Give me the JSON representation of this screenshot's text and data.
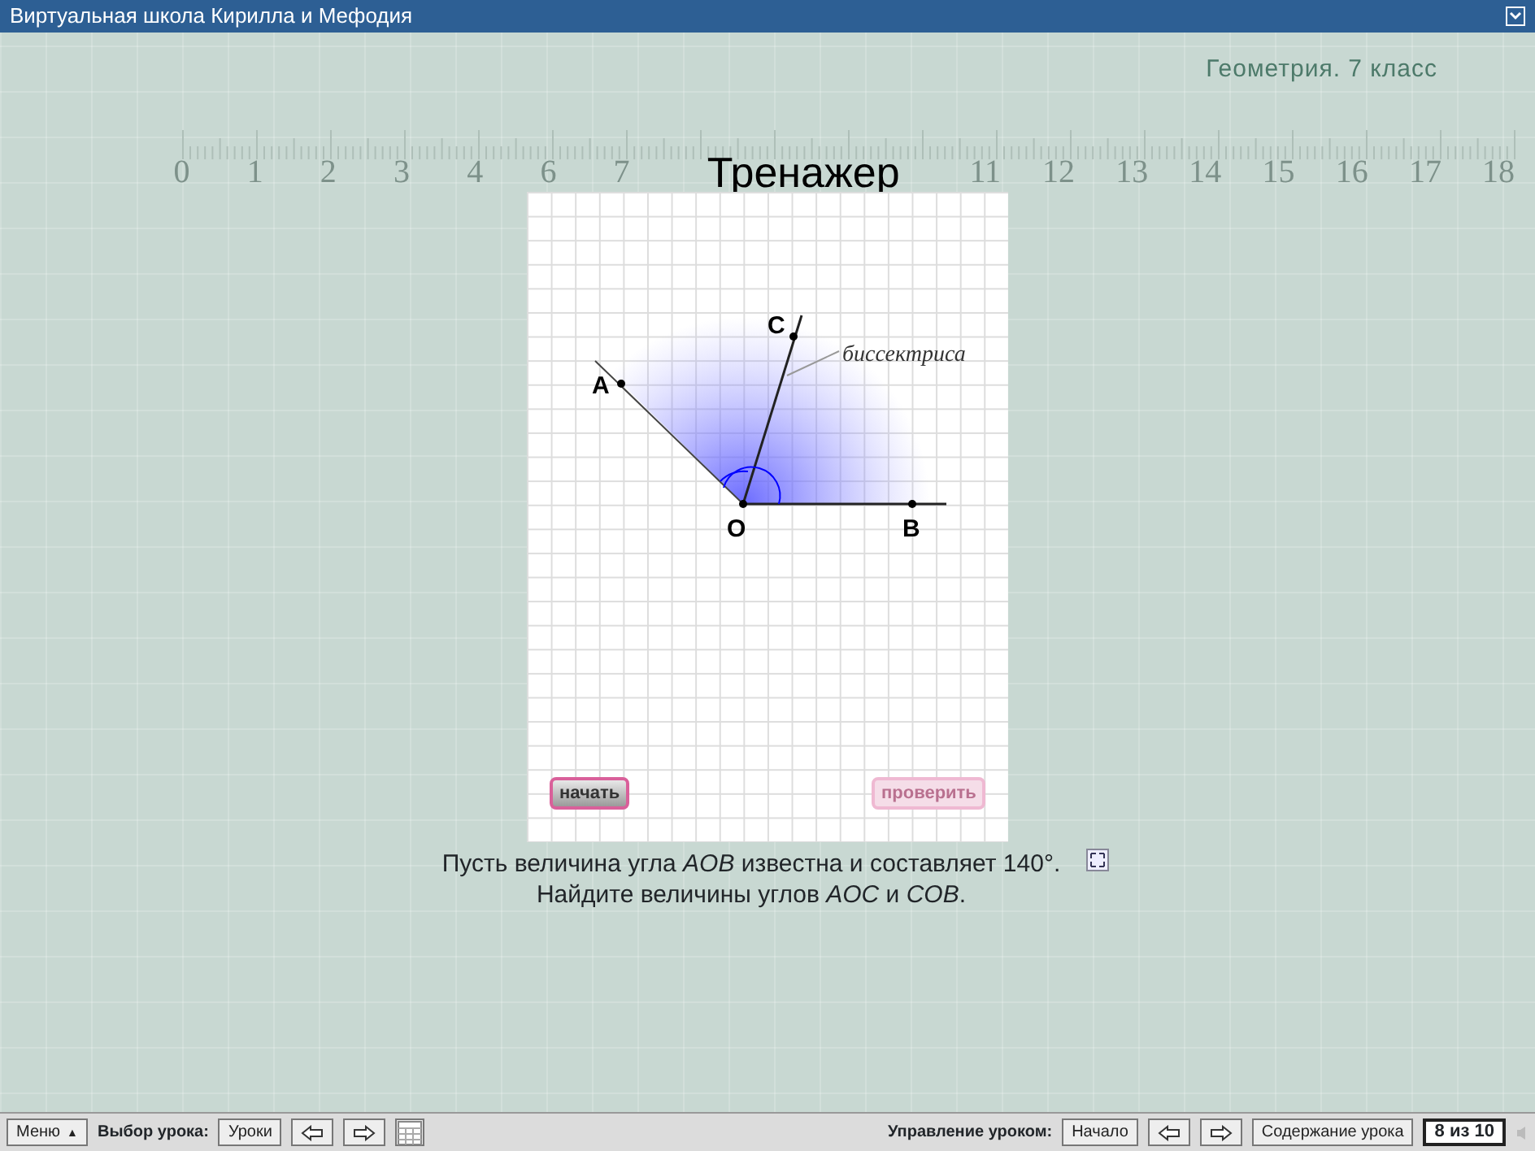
{
  "window": {
    "title": "Виртуальная школа Кирилла и Мефодия"
  },
  "subject": "Геометрия. 7 класс",
  "ruler": {
    "left_numbers": [
      "0",
      "1",
      "2",
      "3",
      "4",
      "6",
      "7"
    ],
    "right_numbers": [
      "11",
      "12",
      "13",
      "14",
      "15",
      "16",
      "17",
      "18"
    ]
  },
  "page_title": "Тренажер",
  "diagram": {
    "points": [
      {
        "label": "A"
      },
      {
        "label": "C"
      },
      {
        "label": "O"
      },
      {
        "label": "B"
      }
    ],
    "bisector_label": "биссектриса"
  },
  "buttons": [
    {
      "label": "начать",
      "disabled": false
    },
    {
      "label": "проверить",
      "disabled": true
    }
  ],
  "task": "Пусть величина угла *AOB* известна и составляет 140°. Найдите величины углов *AOC* и *COB*.",
  "toolbar": {
    "menu": "Меню",
    "menu_caret": "▲",
    "lesson_select_label": "Выбор урока:",
    "lessons_button": "Уроки",
    "lesson_control_label": "Управление уроком:",
    "start_button": "Начало",
    "contents_button": "Содержание урока",
    "page_counter": "8 из 10"
  }
}
